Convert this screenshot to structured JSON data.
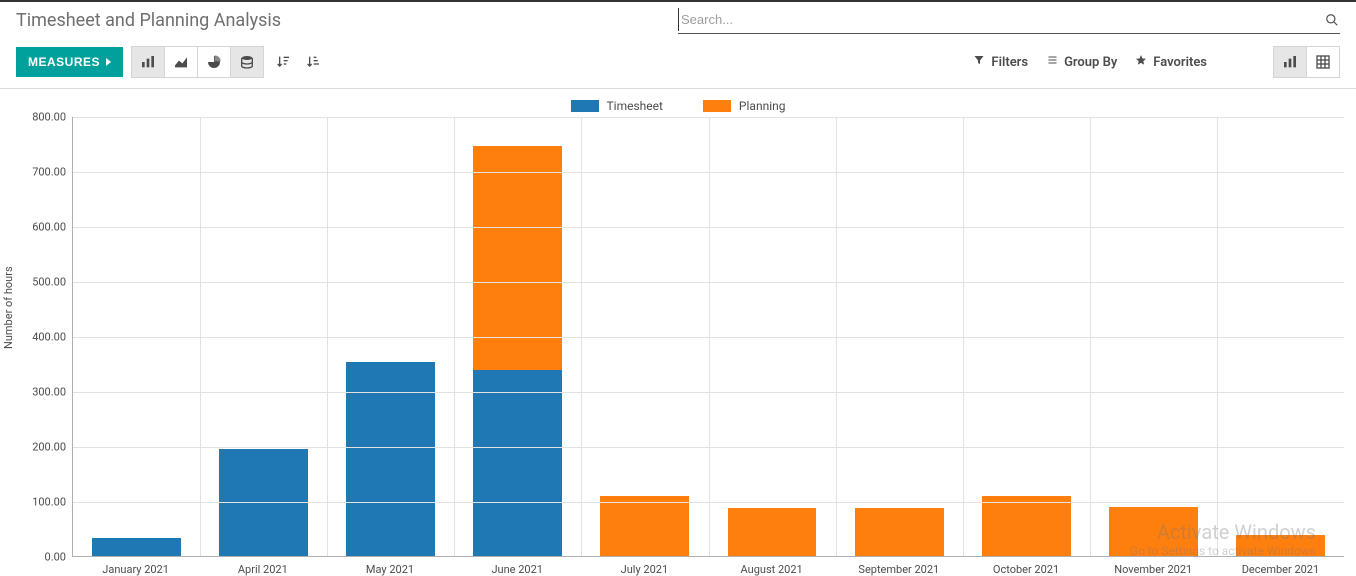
{
  "page": {
    "title": "Timesheet and Planning Analysis"
  },
  "search": {
    "placeholder": "Search..."
  },
  "toolbar": {
    "measures_label": "MEASURES",
    "filters_label": "Filters",
    "groupby_label": "Group By",
    "favorites_label": "Favorites"
  },
  "legend": {
    "timesheet": "Timesheet",
    "planning": "Planning"
  },
  "watermark": {
    "line1": "Activate Windows",
    "line2": "Go to Settings to activate Windows"
  },
  "chart_data": {
    "type": "bar",
    "title": "",
    "xlabel": "",
    "ylabel": "Number of hours",
    "ylim": [
      0,
      800
    ],
    "y_ticks": [
      0,
      100,
      200,
      300,
      400,
      500,
      600,
      700,
      800
    ],
    "categories": [
      "January 2021",
      "April 2021",
      "May 2021",
      "June 2021",
      "July 2021",
      "August 2021",
      "September 2021",
      "October 2021",
      "November 2021",
      "December 2021"
    ],
    "series": [
      {
        "name": "Timesheet",
        "color": "#1f77b4",
        "values": [
          32,
          195,
          352,
          338,
          0,
          0,
          0,
          0,
          0,
          0
        ]
      },
      {
        "name": "Planning",
        "color": "#ff7f0e",
        "values": [
          0,
          0,
          0,
          408,
          110,
          88,
          88,
          110,
          90,
          38
        ]
      }
    ]
  }
}
